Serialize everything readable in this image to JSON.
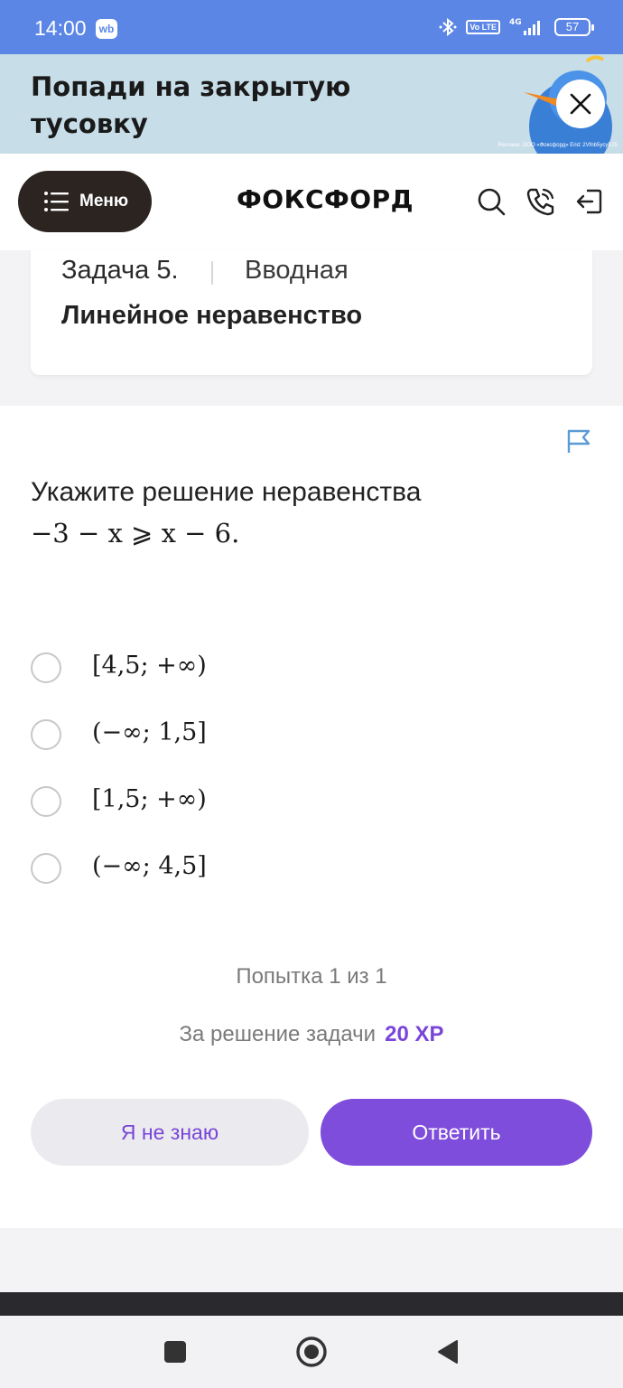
{
  "status_bar": {
    "time": "14:00",
    "app_badge": "wb",
    "network": "4G",
    "volte": "Vo LTE",
    "battery": "57"
  },
  "banner": {
    "title": "Попади на закрытую тусовку",
    "disclaimer": "Реклама. ООО «Фоксфорд» Erid: 2Vfnb5ycyE25"
  },
  "header": {
    "menu_label": "Меню",
    "logo": "ФОКСФОРД"
  },
  "task": {
    "number": "Задача 5.",
    "type": "Вводная",
    "title": "Линейное неравенство"
  },
  "problem": {
    "question": "Укажите решение неравенства",
    "formula": "−3 − x ⩾ x − 6.",
    "options": [
      "[4,5; +∞)",
      "(−∞; 1,5]",
      "[1,5; +∞)",
      "(−∞; 4,5]"
    ],
    "attempt": "Попытка 1 из 1",
    "reward_label": "За решение задачи",
    "reward_xp": "20 XP",
    "dont_know_label": "Я не знаю",
    "answer_label": "Ответить"
  },
  "colors": {
    "status_bar": "#5b86e5",
    "banner": "#c7dde8",
    "accent": "#7f4ddb",
    "menu_button": "#2b2420"
  }
}
